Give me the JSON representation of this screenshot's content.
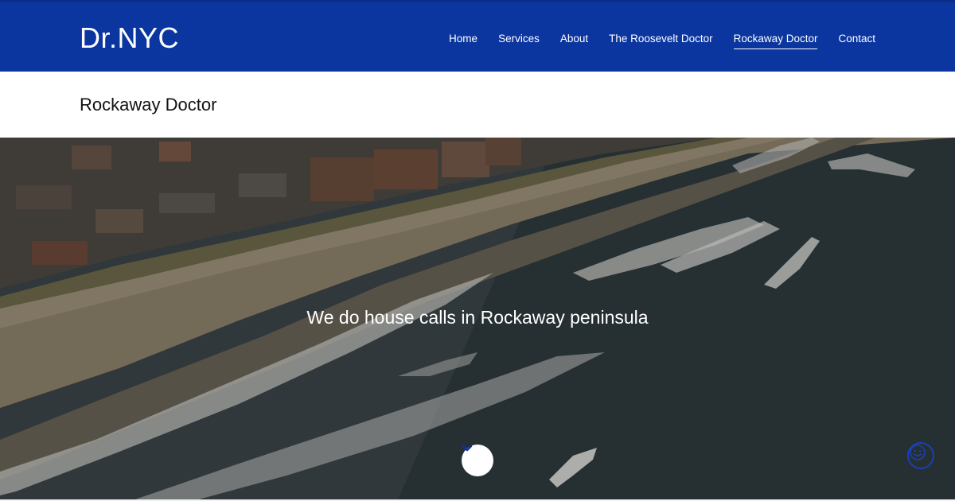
{
  "header": {
    "logo": "Dr.NYC",
    "nav": [
      {
        "label": "Home",
        "active": false
      },
      {
        "label": "Services",
        "active": false
      },
      {
        "label": "About",
        "active": false
      },
      {
        "label": "The Roosevelt Doctor",
        "active": false
      },
      {
        "label": "Rockaway Doctor",
        "active": true
      },
      {
        "label": "Contact",
        "active": false
      }
    ]
  },
  "page": {
    "title": "Rockaway Doctor"
  },
  "hero": {
    "tagline": "We do house calls in Rockaway peninsula",
    "scroll_icon": "chevron-down-icon",
    "chat_icon": "smiley-chat-icon"
  },
  "colors": {
    "brand_blue": "#0b36a0",
    "chat_blue": "#1a40b5",
    "ocean": "#3b4548",
    "sand": "#9a8e76"
  }
}
